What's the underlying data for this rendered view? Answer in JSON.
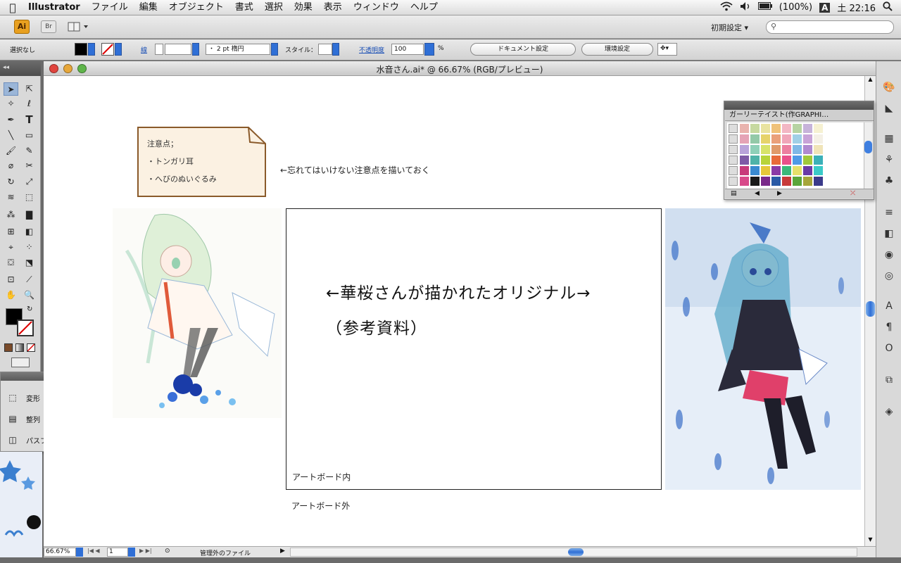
{
  "menubar": {
    "app_name": "Illustrator",
    "items": [
      "ファイル",
      "編集",
      "オブジェクト",
      "書式",
      "選択",
      "効果",
      "表示",
      "ウィンドウ",
      "ヘルプ"
    ],
    "battery": "(100%)",
    "input_method": "A",
    "clock": "土 22:16"
  },
  "appbar": {
    "ai_label": "Ai",
    "br_label": "Br",
    "workspace": "初期設定 ▾"
  },
  "control": {
    "selection": "選択なし",
    "stroke_label": "線",
    "brush_value": "・  2 pt 楕円",
    "style_label": "スタイル：",
    "opacity_label": "不透明度",
    "opacity_value": "100",
    "percent": "%",
    "doc_settings": "ドキュメント設定",
    "prefs": "環境設定"
  },
  "document": {
    "title": "水音さん.ai* @ 66.67% (RGB/プレビュー)"
  },
  "float_panel": {
    "items": [
      "変形",
      "整列",
      "パスファインダ"
    ]
  },
  "swatches": {
    "title": "ガーリーテイスト(作GRAPHI…",
    "colors": [
      "#e9b3ae",
      "#c7d9a0",
      "#e9e3a0",
      "#f0c27a",
      "#f3b7c4",
      "#b7d3a3",
      "#c7b3da",
      "#f6f1d2",
      "#e5a3b6",
      "#93c9a8",
      "#e6d36a",
      "#eaa07a",
      "#f0a6b9",
      "#a0cfe6",
      "#c8a3d8",
      "#f4f0e6",
      "#b9a3da",
      "#8fd0b8",
      "#d8e36a",
      "#e09a6a",
      "#ec7fa0",
      "#7fb8e6",
      "#b08ad0",
      "#f0e4b8",
      "#7f5aa6",
      "#4fb3a8",
      "#b8d43a",
      "#e86a3a",
      "#e94f8a",
      "#4f9ae6",
      "#a0c83a",
      "#3ab0b8",
      "#c83a7a",
      "#3a8ad0",
      "#e6c83a",
      "#8a3aa6",
      "#3ab87a",
      "#e6e06a",
      "#6a3aa6",
      "#3acac8",
      "#d84a8a",
      "#1a1a1a",
      "#7a2a8a",
      "#2a5aa6",
      "#c83a3a",
      "#5aa63a",
      "#a6a63a",
      "#3a3a8a"
    ]
  },
  "canvas": {
    "note_lines": [
      "注意点；",
      "・トンガリ耳",
      "・へびのぬいぐるみ"
    ],
    "note_arrow": "←忘れてはいけない注意点を描いておく",
    "artboard_title": "←華桜さんが描かれたオリジナル→",
    "artboard_sub": "（参考資料）",
    "inside_label": "アートボード内",
    "outside_label": "アートボード外"
  },
  "statusbar": {
    "zoom": "66.67%",
    "page": "1",
    "status": "管理外のファイル"
  }
}
